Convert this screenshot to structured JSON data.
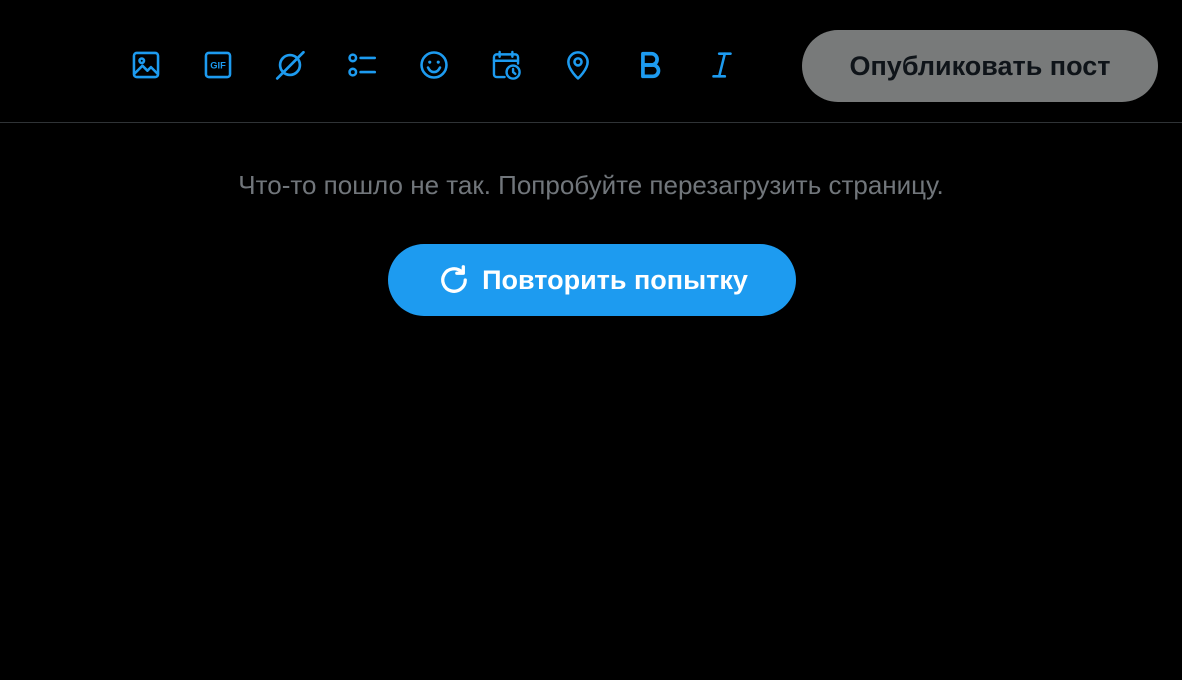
{
  "toolbar": {
    "icons": [
      {
        "name": "media-icon",
        "label": "Медиа"
      },
      {
        "name": "gif-icon",
        "label": "GIF"
      },
      {
        "name": "grok-icon",
        "label": "Grok"
      },
      {
        "name": "poll-icon",
        "label": "Опрос"
      },
      {
        "name": "emoji-icon",
        "label": "Эмодзи"
      },
      {
        "name": "schedule-icon",
        "label": "Запланировать"
      },
      {
        "name": "location-icon",
        "label": "Место"
      },
      {
        "name": "bold-icon",
        "label": "Полужирный"
      },
      {
        "name": "italic-icon",
        "label": "Курсив"
      }
    ],
    "gif_text": "GIF",
    "publish_label": "Опубликовать пост"
  },
  "error": {
    "message": "Что-то пошло не так. Попробуйте перезагрузить страницу.",
    "retry_label": "Повторить попытку"
  },
  "colors": {
    "accent": "#1d9bf0",
    "background": "#000000",
    "muted_text": "#71767b",
    "disabled_button": "#787a7a",
    "divider": "#2f3336"
  }
}
